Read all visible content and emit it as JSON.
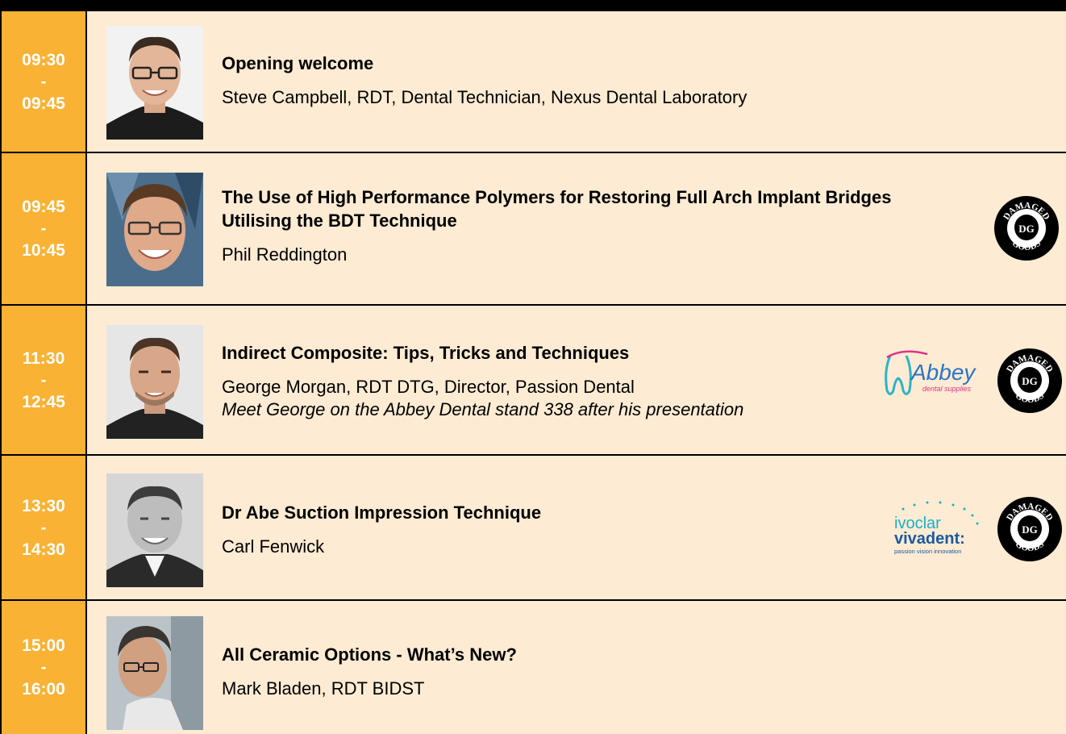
{
  "sessions": [
    {
      "start": "09:30",
      "sep": "-",
      "end": "09:45",
      "title": "Opening welcome",
      "speaker": "Steve Campbell, RDT, Dental Technician, Nexus Dental Laboratory",
      "note": "",
      "sponsors": []
    },
    {
      "start": "09:45",
      "sep": "-",
      "end": "10:45",
      "title": "The Use of High Performance Polymers for Restoring Full Arch Implant Bridges Utilising the BDT Technique",
      "speaker": "Phil Reddington",
      "note": "",
      "sponsors": [
        "damaged-goods"
      ]
    },
    {
      "start": "11:30",
      "sep": "-",
      "end": "12:45",
      "title": "Indirect Composite: Tips, Tricks and Techniques",
      "speaker": "George Morgan, RDT DTG, Director, Passion Dental",
      "note": "Meet George on the Abbey Dental stand 338 after his presentation",
      "sponsors": [
        "abbey",
        "damaged-goods"
      ]
    },
    {
      "start": "13:30",
      "sep": "-",
      "end": "14:30",
      "title": "Dr Abe Suction Impression Technique",
      "speaker": "Carl Fenwick",
      "note": "",
      "sponsors": [
        "ivoclar",
        "damaged-goods"
      ]
    },
    {
      "start": "15:00",
      "sep": "-",
      "end": "16:00",
      "title": "All Ceramic Options - What’s New?",
      "speaker": "Mark Bladen, RDT BIDST",
      "note": "",
      "sponsors": []
    }
  ],
  "logos": {
    "damaged_goods_top": "DAMAGED",
    "damaged_goods_bottom": "GOODS",
    "damaged_goods_mono": "DG",
    "abbey_name": "Abbey",
    "abbey_sub": "dental supplies",
    "ivoclar_line1": "ivoclar",
    "ivoclar_line2": "vivadent:",
    "ivoclar_tagline": "passion vision innovation"
  },
  "colors": {
    "time_bg": "#f9b234",
    "row_bg": "#fdebd3",
    "border": "#000000"
  }
}
